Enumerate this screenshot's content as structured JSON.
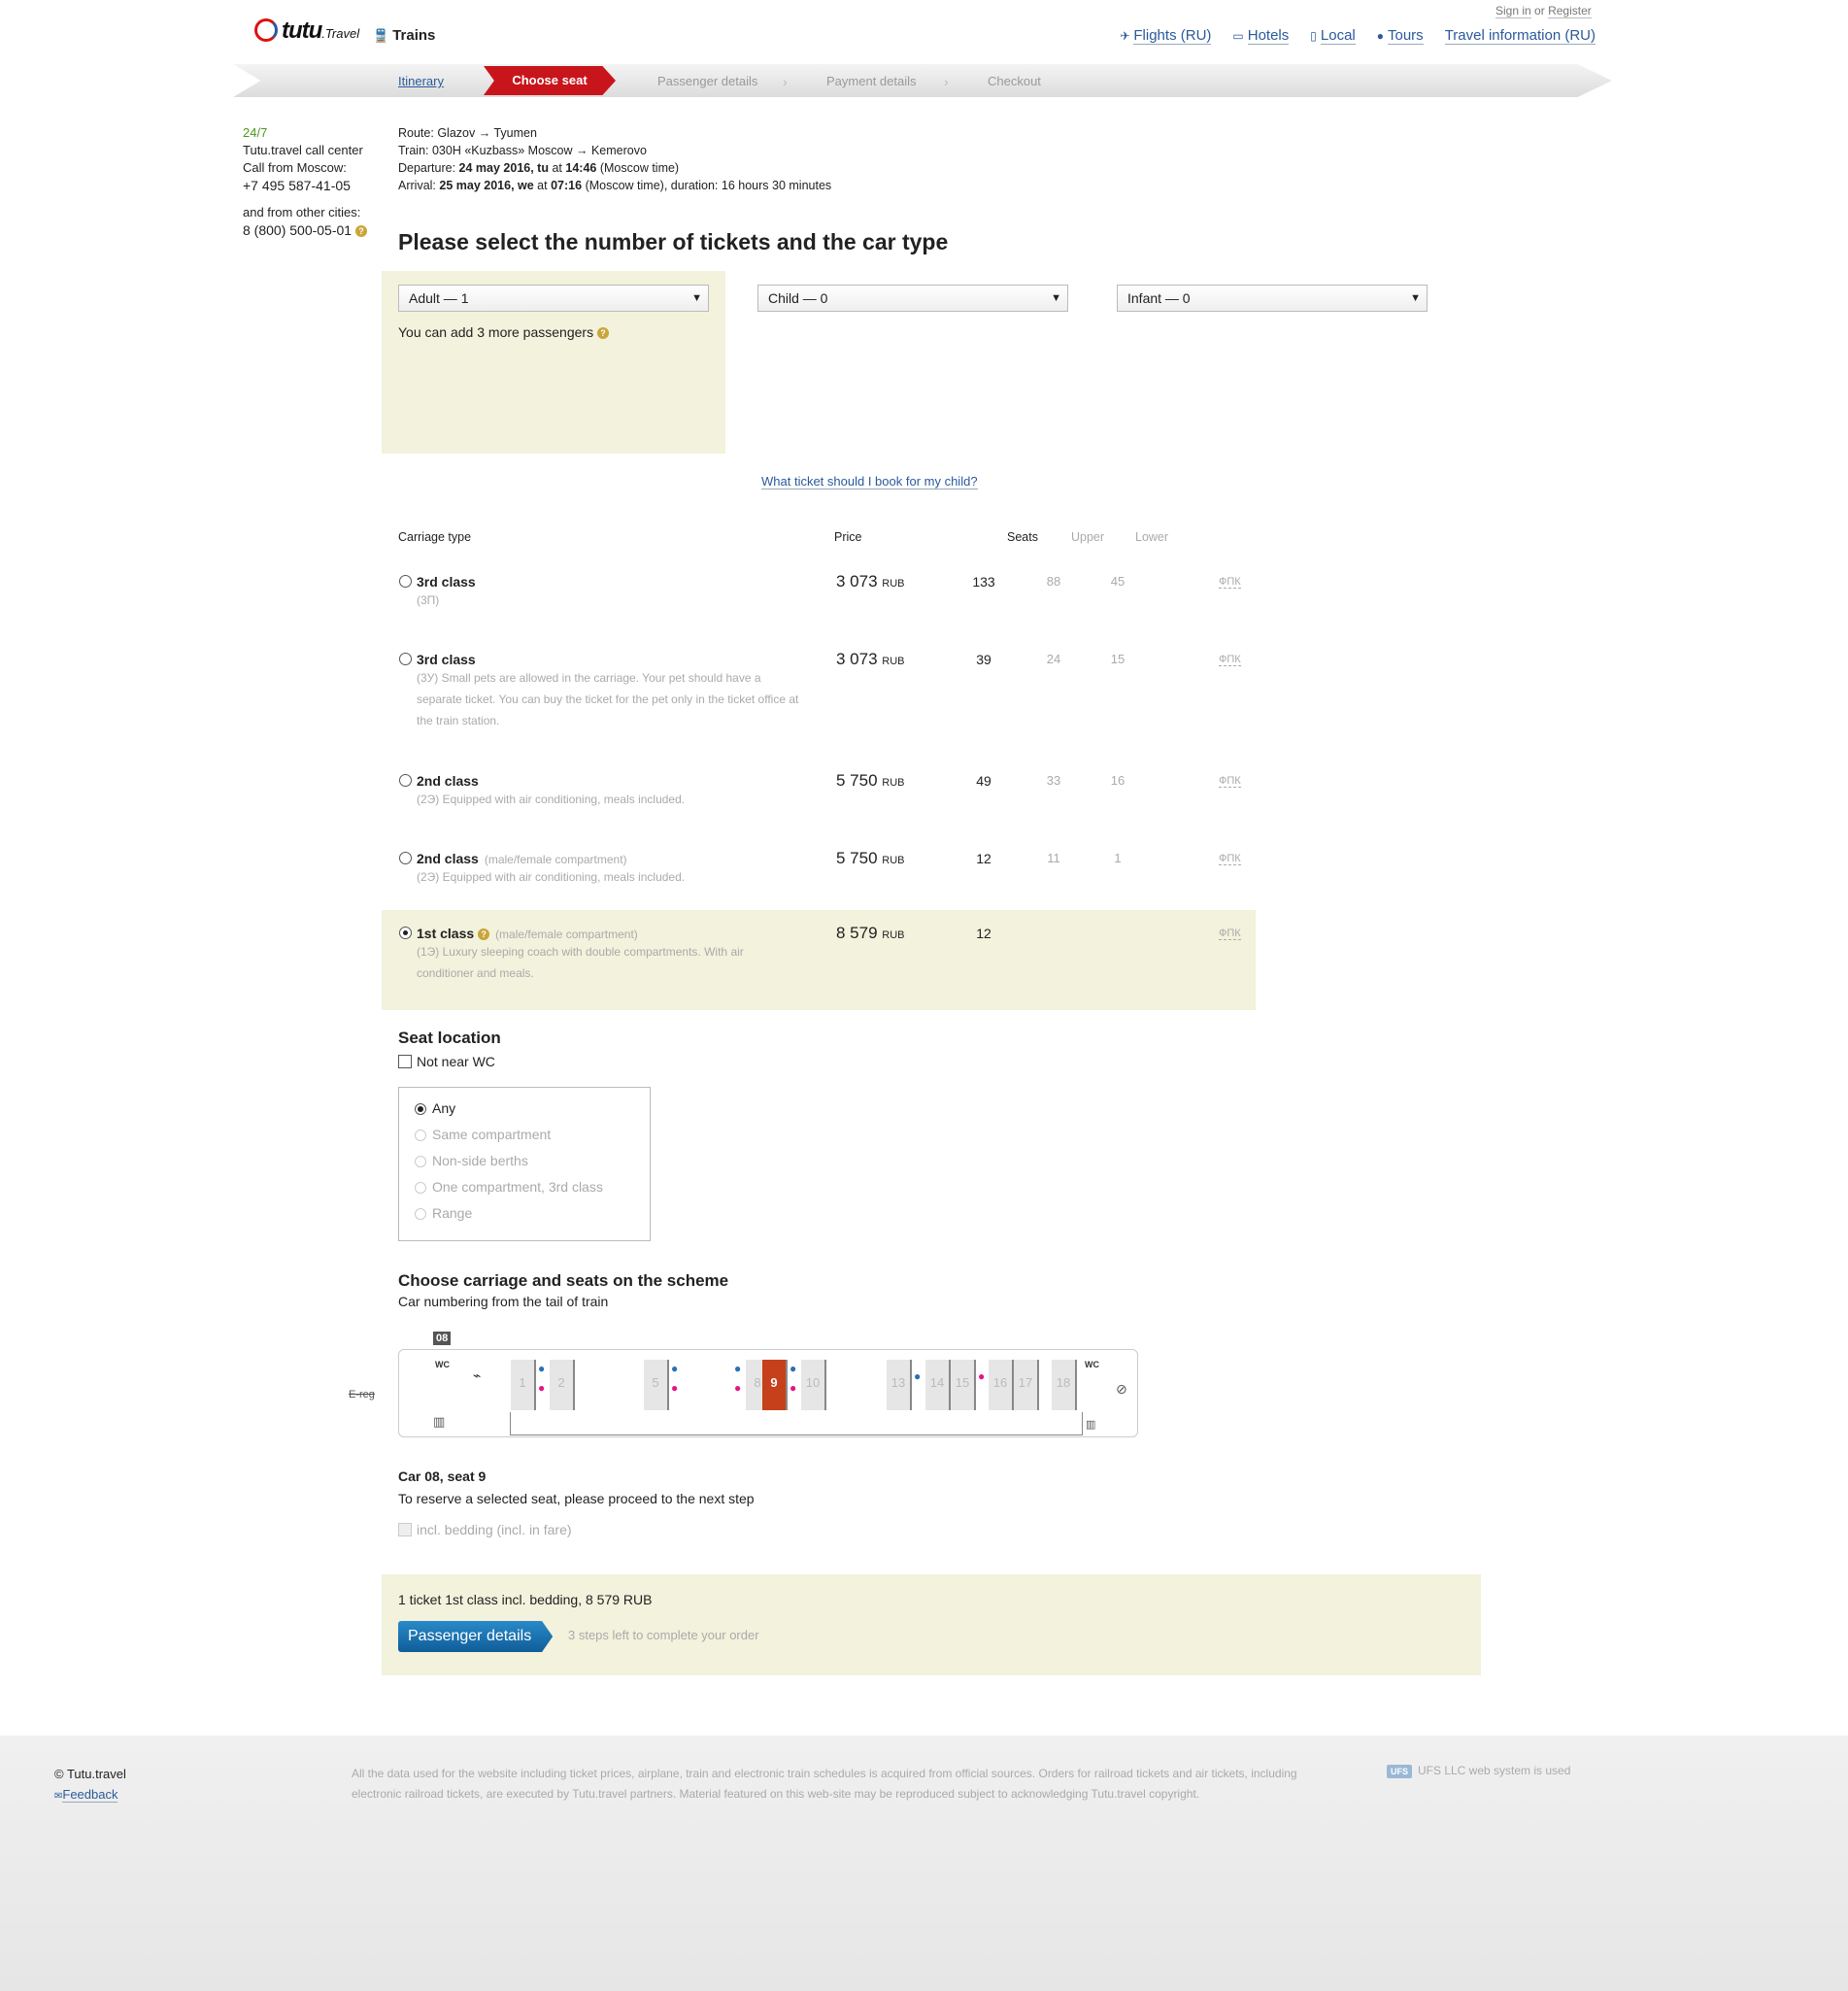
{
  "header": {
    "logo_main": "tutu",
    "logo_suffix": ".Travel",
    "section": "Trains",
    "sign_in": "Sign in",
    "or": "or",
    "register": "Register",
    "nav": [
      {
        "label": "Flights (RU)",
        "icon": "plane-icon"
      },
      {
        "label": "Hotels",
        "icon": "bed-icon"
      },
      {
        "label": "Local",
        "icon": "train-icon"
      },
      {
        "label": "Tours",
        "icon": "pin-icon"
      },
      {
        "label": "Travel information (RU)",
        "icon": ""
      }
    ]
  },
  "steps": {
    "itinerary": "Itinerary",
    "choose_seat": "Choose seat",
    "passenger_details": "Passenger details",
    "payment_details": "Payment details",
    "checkout": "Checkout"
  },
  "call_center": {
    "hours": "24/7",
    "title": "Tutu.travel call center",
    "from_moscow": "Call from Moscow:",
    "moscow_phone": "+7 495 587-41-05",
    "from_other": "and from other cities:",
    "other_phone": "8 (800) 500-05-01"
  },
  "route": {
    "route_label": "Route:",
    "route_value": "Glazov → Tyumen",
    "train_label": "Train:",
    "train_value": "030Н «Kuzbass» Moscow → Kemerovo",
    "departure_label": "Departure:",
    "departure_date": "24 may 2016, tu",
    "departure_at": "at",
    "departure_time": "14:46",
    "departure_tz": "(Moscow time)",
    "arrival_label": "Arrival:",
    "arrival_date": "25 may 2016, we",
    "arrival_at": "at",
    "arrival_time": "07:16",
    "arrival_tz": "(Moscow time), duration: 16 hours 30 minutes"
  },
  "tickets": {
    "heading": "Please select the number of tickets and the car type",
    "adult": "Adult — 1",
    "child": "Child — 0",
    "infant": "Infant — 0",
    "hint": "You can add 3 more passengers",
    "child_link": "What ticket should I book for my child?"
  },
  "table": {
    "headers": {
      "type": "Carriage type",
      "price": "Price",
      "seats": "Seats",
      "upper": "Upper",
      "lower": "Lower"
    },
    "rows": [
      {
        "name": "3rd class",
        "sub": "",
        "desc": "(3П)",
        "price": "3 073",
        "currency": "RUB",
        "seats": "133",
        "upper": "88",
        "lower": "45",
        "fpk": "ФПК",
        "selected": false
      },
      {
        "name": "3rd class",
        "sub": "",
        "desc": "(3У) Small pets are allowed in the carriage. Your pet should have a separate ticket. You can buy the ticket for the pet only in the ticket office at the train station.",
        "price": "3 073",
        "currency": "RUB",
        "seats": "39",
        "upper": "24",
        "lower": "15",
        "fpk": "ФПК",
        "selected": false
      },
      {
        "name": "2nd class",
        "sub": "",
        "desc": "(2Э) Equipped with air conditioning, meals included.",
        "price": "5 750",
        "currency": "RUB",
        "seats": "49",
        "upper": "33",
        "lower": "16",
        "fpk": "ФПК",
        "selected": false
      },
      {
        "name": "2nd class",
        "sub": "(male/female compartment)",
        "desc": "(2Э) Equipped with air conditioning, meals included.",
        "price": "5 750",
        "currency": "RUB",
        "seats": "12",
        "upper": "11",
        "lower": "1",
        "fpk": "ФПК",
        "selected": false
      },
      {
        "name": "1st class",
        "sub": "(male/female compartment)",
        "desc": "(1Э) Luxury sleeping coach with double compartments. With air conditioner and meals.",
        "price": "8 579",
        "currency": "RUB",
        "seats": "12",
        "upper": "",
        "lower": "",
        "fpk": "ФПК",
        "selected": true
      }
    ]
  },
  "seat_location": {
    "heading": "Seat location",
    "not_near_wc": "Not near WC",
    "options": [
      "Any",
      "Same compartment",
      "Non-side berths",
      "One compartment, 3rd class",
      "Range"
    ],
    "selected": "Any"
  },
  "scheme": {
    "heading": "Choose carriage and seats on the scheme",
    "subheading": "Car numbering from the tail of train",
    "car_number": "08",
    "ereg": "E-reg",
    "wc": "WC",
    "seats": [
      "1",
      "2",
      "5",
      "8",
      "9",
      "10",
      "13",
      "14",
      "15",
      "16",
      "17",
      "18"
    ],
    "selected_seat": "9",
    "selection_title": "Car 08, seat 9",
    "selection_note": "To reserve a selected seat, please proceed to the next step",
    "bedding": "incl. bedding (incl. in fare)"
  },
  "summary": {
    "text": "1 ticket 1st class incl. bedding, 8 579 RUB",
    "button": "Passenger details",
    "steps_left": "3 steps left to complete your order"
  },
  "footer": {
    "copyright": "© Tutu.travel",
    "feedback": "Feedback",
    "legal": "All the data used for the website including ticket prices, airplane, train and electronic train schedules is acquired from official sources. Orders for railroad tickets and air tickets, including electronic railroad tickets, are executed by Tutu.travel partners. Material featured on this web-site may be reproduced subject to acknowledging Tutu.travel copyright.",
    "ufs_badge": "UFS",
    "ufs_text": "UFS LLC web system is used"
  }
}
